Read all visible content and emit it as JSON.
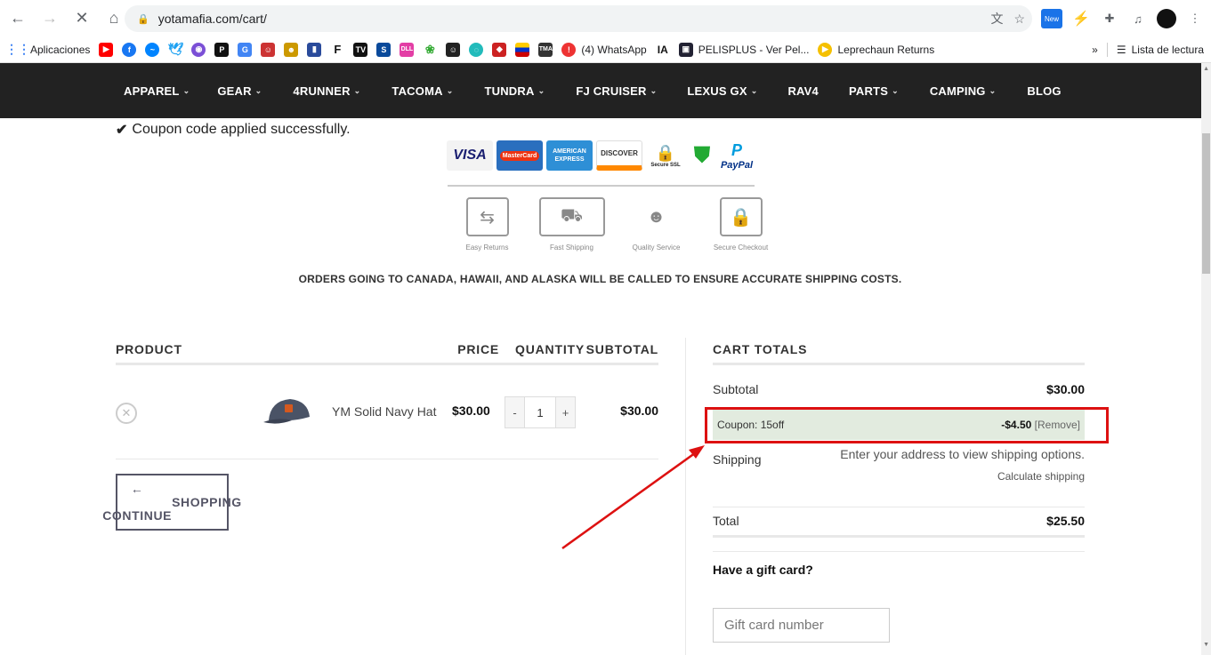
{
  "browser": {
    "url": "yotamafia.com/cart/",
    "bookmarks": {
      "apps_label": "Aplicaciones",
      "whatsapp": "(4) WhatsApp",
      "pelisplus": "PELISPLUS - Ver Pel...",
      "leprechaun": "Leprechaun Returns",
      "reading_list": "Lista de lectura",
      "overflow": "»"
    },
    "new_badge": "New"
  },
  "site_nav": {
    "items": [
      "APPAREL",
      "GEAR",
      "4RUNNER",
      "TACOMA",
      "TUNDRA",
      "FJ CRUISER",
      "LEXUS GX",
      "RAV4",
      "PARTS",
      "CAMPING",
      "BLOG"
    ],
    "caret": "⌄"
  },
  "notice": {
    "coupon_applied": "Coupon code applied successfully."
  },
  "payment_logos": [
    "VISA",
    "MasterCard",
    "AMERICAN EXPRESS",
    "DISCOVER",
    "Secure SSL",
    "",
    "PayPal"
  ],
  "features": [
    "Easy Returns",
    "Fast Shipping",
    "Quality Service",
    "Secure Checkout"
  ],
  "shipping_note": "ORDERS GOING TO CANADA, HAWAII, AND ALASKA WILL BE CALLED TO ENSURE ACCURATE SHIPPING COSTS.",
  "cart": {
    "headers": {
      "product": "PRODUCT",
      "price": "PRICE",
      "quantity": "QUANTITY",
      "subtotal": "SUBTOTAL"
    },
    "items": [
      {
        "name": "YM Solid Navy Hat",
        "price": "$30.00",
        "quantity": "1",
        "subtotal": "$30.00"
      }
    ],
    "qty_minus": "-",
    "qty_plus": "+",
    "continue_label": "← CONTINUE SHOPPING"
  },
  "totals": {
    "heading": "CART TOTALS",
    "subtotal_label": "Subtotal",
    "subtotal_value": "$30.00",
    "coupon_label": "Coupon: 15off",
    "coupon_value": "-$4.50",
    "coupon_remove": "[Remove]",
    "shipping_label": "Shipping",
    "shipping_message": "Enter your address to view shipping options.",
    "calculate_shipping": "Calculate shipping",
    "total_label": "Total",
    "total_value": "$25.50"
  },
  "gift_card": {
    "heading": "Have a gift card?",
    "placeholder": "Gift card number"
  },
  "colors": {
    "nav_bg": "#222222",
    "coupon_row_bg": "#e2ebdf",
    "annotation_red": "#dd1111"
  }
}
